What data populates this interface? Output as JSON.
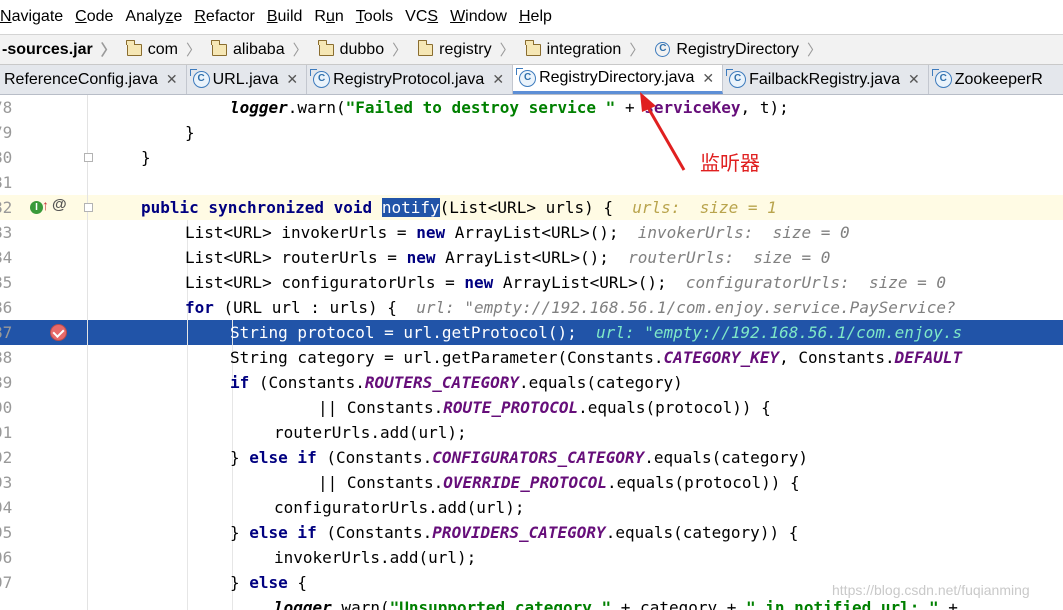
{
  "menu": [
    {
      "pre": "",
      "mn": "N",
      "post": "avigate"
    },
    {
      "pre": "",
      "mn": "C",
      "post": "ode"
    },
    {
      "pre": "Analy",
      "mn": "z",
      "post": "e"
    },
    {
      "pre": "",
      "mn": "R",
      "post": "efactor"
    },
    {
      "pre": "",
      "mn": "B",
      "post": "uild"
    },
    {
      "pre": "R",
      "mn": "u",
      "post": "n"
    },
    {
      "pre": "",
      "mn": "T",
      "post": "ools"
    },
    {
      "pre": "VC",
      "mn": "S",
      "post": ""
    },
    {
      "pre": "",
      "mn": "W",
      "post": "indow"
    },
    {
      "pre": "",
      "mn": "H",
      "post": "elp"
    }
  ],
  "breadcrumb": {
    "jar": "-sources.jar",
    "packages": [
      "com",
      "alibaba",
      "dubbo",
      "registry",
      "integration"
    ],
    "klass": "RegistryDirectory"
  },
  "tabs": [
    {
      "label": "ReferenceConfig.java"
    },
    {
      "label": "URL.java"
    },
    {
      "label": "RegistryProtocol.java"
    },
    {
      "label": "RegistryDirectory.java"
    },
    {
      "label": "FailbackRegistry.java"
    },
    {
      "label": "ZookeeperR"
    }
  ],
  "icons": {
    "class_letter": "C",
    "close": "✕",
    "impl_letter": "I",
    "at": "@"
  },
  "lines": {
    "78": {
      "num": "78",
      "a": "logger",
      "b": ".warn(",
      "c": "\"Failed to destroy service \"",
      "d": " + ",
      "e": "serviceKey",
      "f": ", t);"
    },
    "79": {
      "num": "79",
      "t": "}"
    },
    "80": {
      "num": "80",
      "t": "}"
    },
    "81": {
      "num": "81"
    },
    "82": {
      "num": "82",
      "k1": "public synchronized void",
      "sp": " ",
      "sel": "notify",
      "rest": "(List<URL> urls) {",
      "hint": "urls:  size = 1"
    },
    "83": {
      "num": "83",
      "a": "List<URL> invokerUrls = ",
      "k": "new",
      "b": " ArrayList<URL>();",
      "hint": "invokerUrls:  size = 0"
    },
    "84": {
      "num": "84",
      "a": "List<URL> routerUrls = ",
      "k": "new",
      "b": " ArrayList<URL>();",
      "hint": "routerUrls:  size = 0"
    },
    "85": {
      "num": "85",
      "a": "List<URL> configuratorUrls = ",
      "k": "new",
      "b": " ArrayList<URL>();",
      "hint": "configuratorUrls:  size = 0"
    },
    "86": {
      "num": "86",
      "k": "for",
      "b": " (URL url : urls) {",
      "hint": "url: \"empty://192.168.56.1/com.enjoy.service.PayService?"
    },
    "87": {
      "num": "87",
      "t": "String protocol = url.getProtocol();",
      "hint": "url: \"empty://192.168.56.1/com.enjoy.s"
    },
    "88": {
      "num": "88",
      "a": "String category = url.getParameter(Constants.",
      "c1": "CATEGORY_KEY",
      "b": ", Constants.",
      "c2": "DEFAULT"
    },
    "89": {
      "num": "89",
      "k": "if",
      "a": " (Constants.",
      "c": "ROUTERS_CATEGORY",
      "b": ".equals(category)"
    },
    "90": {
      "num": "90",
      "a": "|| Constants.",
      "c": "ROUTE_PROTOCOL",
      "b": ".equals(protocol)) {"
    },
    "91": {
      "num": "91",
      "t": "routerUrls.add(url);"
    },
    "92": {
      "num": "92",
      "a": "} ",
      "k": "else if",
      "b": " (Constants.",
      "c": "CONFIGURATORS_CATEGORY",
      "d": ".equals(category)"
    },
    "93": {
      "num": "93",
      "a": "|| Constants.",
      "c": "OVERRIDE_PROTOCOL",
      "b": ".equals(protocol)) {"
    },
    "94": {
      "num": "94",
      "t": "configuratorUrls.add(url);"
    },
    "95": {
      "num": "95",
      "a": "} ",
      "k": "else if",
      "b": " (Constants.",
      "c": "PROVIDERS_CATEGORY",
      "d": ".equals(category)) {"
    },
    "96": {
      "num": "96",
      "t": "invokerUrls.add(url);"
    },
    "97": {
      "num": "97",
      "a": "} ",
      "k": "else",
      "b": " {"
    },
    "98": {
      "a": "logger",
      "b": ".warn(",
      "c": "\"Unsupported category \"",
      "d": " + category + ",
      "e": "\" in notified url: \"",
      "f": " + "
    }
  },
  "annotation": "监听器",
  "watermark": "https://blog.csdn.net/fuqianming",
  "colors": {
    "selection": "#2154a8",
    "keyword": "#000080",
    "string": "#008000",
    "constant": "#660e7a",
    "annotation": "#e02020"
  }
}
